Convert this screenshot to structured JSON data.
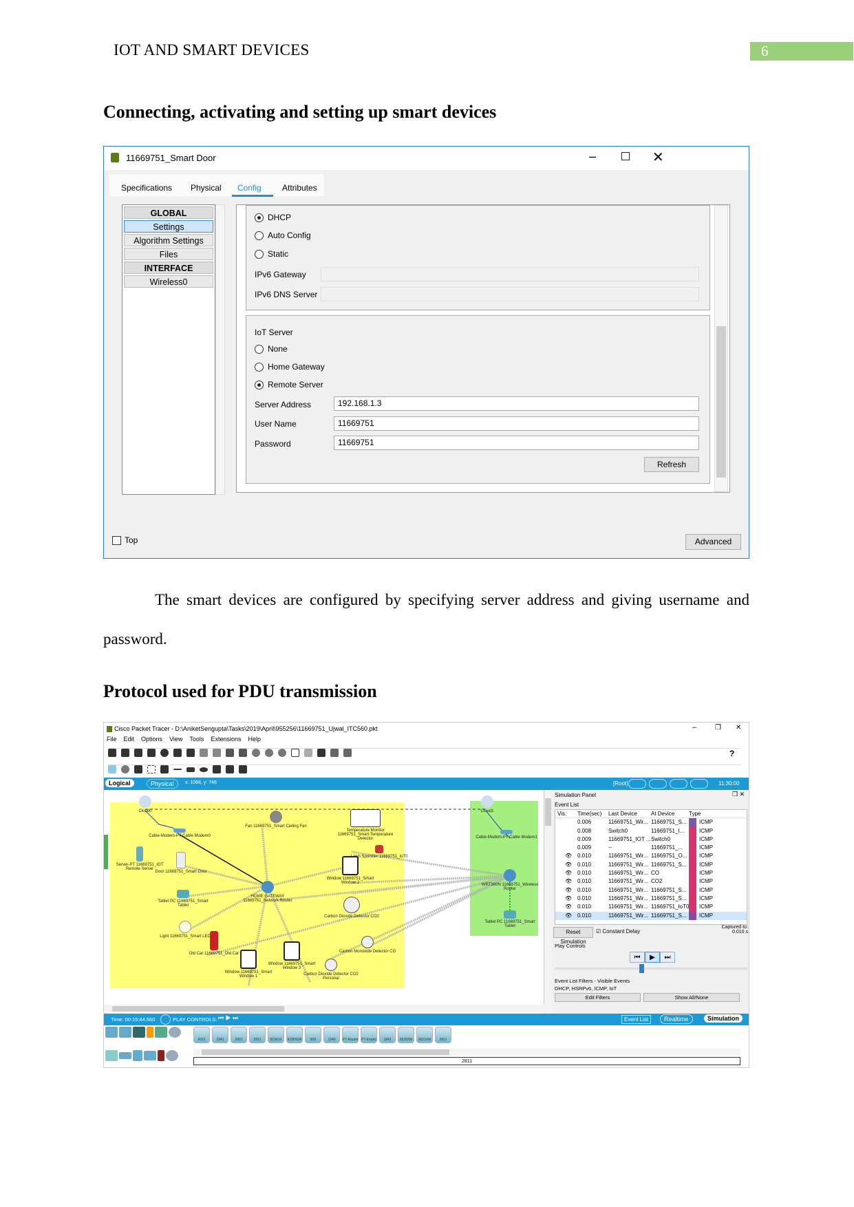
{
  "header": {
    "title": "IOT AND SMART DEVICES",
    "page_number": "6"
  },
  "section1": {
    "heading": "Connecting, activating and setting up smart devices"
  },
  "dialog": {
    "title": "11669751_Smart Door",
    "tabs": [
      "Specifications",
      "Physical",
      "Config",
      "Attributes"
    ],
    "active_tab": "Config",
    "left_items": [
      "GLOBAL",
      "Settings",
      "Algorithm Settings",
      "Files",
      "INTERFACE",
      "Wireless0"
    ],
    "ipv6": {
      "options": [
        {
          "label": "DHCP",
          "selected": true
        },
        {
          "label": "Auto Config",
          "selected": false
        },
        {
          "label": "Static",
          "selected": false
        }
      ],
      "gateway_label": "IPv6 Gateway",
      "gateway_value": "",
      "dns_label": "IPv6 DNS Server",
      "dns_value": ""
    },
    "iot": {
      "label": "IoT Server",
      "options": [
        {
          "label": "None",
          "selected": false
        },
        {
          "label": "Home Gateway",
          "selected": false
        },
        {
          "label": "Remote Server",
          "selected": true
        }
      ],
      "server_label": "Server Address",
      "server_value": "192.168.1.3",
      "user_label": "User Name",
      "user_value": "11669751",
      "password_label": "Password",
      "password_value": "11669751",
      "refresh": "Refresh"
    },
    "top_label": "Top",
    "top_checked": false,
    "advanced": "Advanced"
  },
  "paragraph": "The smart devices are configured by specifying server address and giving username and password.",
  "section2": {
    "heading": "Protocol used for PDU transmission"
  },
  "pt": {
    "title": "Cisco Packet Tracer - D:\\AniketSengupta\\Tasks\\2019\\April\\955256\\11669751_Ujwal_ITC560.pkt",
    "menu": [
      "File",
      "Edit",
      "Options",
      "View",
      "Tools",
      "Extensions",
      "Help"
    ],
    "help": "?",
    "logical": "Logical",
    "physical": "Physical",
    "coords": "x: 1088, y: 746",
    "root": "[Root]",
    "clock": "11:30:00",
    "devices": [
      {
        "label": "Cloud0"
      },
      {
        "label": "Cable-Modem-PT Cable Modem0"
      },
      {
        "label": "Server-PT 11669751_IOT Remote Server"
      },
      {
        "label": "Fan 11669751_Smart Ceiling Fan"
      },
      {
        "label": "Temperature Monitor 11669751_Smart Temperature Detector"
      },
      {
        "label": "Door 11669751_Smart Door"
      },
      {
        "label": "Lawn Sprinkler 11669751_IoT0"
      },
      {
        "label": "Window 11669751_Smart Window 2"
      },
      {
        "label": "HOME GATEWAY 11669751_Network Router"
      },
      {
        "label": "Tablet PC 11669751_Smart Tablet"
      },
      {
        "label": "Carbon Dioxide Detector CO2"
      },
      {
        "label": "Light 11669751_Smart LED"
      },
      {
        "label": "Old Car 11669751_Old Car"
      },
      {
        "label": "Window 11669751_Smart Window 1"
      },
      {
        "label": "Window 11669751_Smart Window 3"
      },
      {
        "label": "Carbon Monoxide Detector CO"
      },
      {
        "label": "Carbon Dioxide Detector CO2 Personal"
      },
      {
        "label": "Cloud1"
      },
      {
        "label": "Cable-Modem-PT Cable Modem1"
      },
      {
        "label": "WRT300N 11669751_Wireless Router"
      },
      {
        "label": "Tablet PC 11669751_Smart Tablet"
      }
    ],
    "sim": {
      "title": "Simulation Panel",
      "event_list": "Event List",
      "columns": [
        "Vis.",
        "Time(sec)",
        "Last Device",
        "At Device",
        "Type"
      ],
      "events": [
        {
          "vis": false,
          "time": "0.006",
          "last": "11669751_Wir...",
          "at": "11669751_S...",
          "type": "ICMP",
          "color": "#7a5aa8"
        },
        {
          "vis": false,
          "time": "0.008",
          "last": "Switch0",
          "at": "11669751_I...",
          "type": "ICMP",
          "color": "#d9336e"
        },
        {
          "vis": false,
          "time": "0.009",
          "last": "11669751_IOT ...",
          "at": "Switch0",
          "type": "ICMP",
          "color": "#d9336e"
        },
        {
          "vis": false,
          "time": "0.009",
          "last": "--",
          "at": "11669751_...",
          "type": "ICMP",
          "color": "#d9336e"
        },
        {
          "vis": true,
          "time": "0.010",
          "last": "11669751_Wir...",
          "at": "11669751_O...",
          "type": "ICMP",
          "color": "#d9336e"
        },
        {
          "vis": true,
          "time": "0.010",
          "last": "11669751_Wir...",
          "at": "11669751_S...",
          "type": "ICMP",
          "color": "#d9336e"
        },
        {
          "vis": true,
          "time": "0.010",
          "last": "11669751_Wir...",
          "at": "CO",
          "type": "ICMP",
          "color": "#d9336e"
        },
        {
          "vis": true,
          "time": "0.010",
          "last": "11669751_Wir...",
          "at": "CO2",
          "type": "ICMP",
          "color": "#d9336e"
        },
        {
          "vis": true,
          "time": "0.010",
          "last": "11669751_Wir...",
          "at": "11669751_S...",
          "type": "ICMP",
          "color": "#d9336e"
        },
        {
          "vis": true,
          "time": "0.010",
          "last": "11669751_Wir...",
          "at": "11669751_S...",
          "type": "ICMP",
          "color": "#d9336e"
        },
        {
          "vis": true,
          "time": "0.010",
          "last": "11669751_Wir...",
          "at": "11669751_IoT0",
          "type": "ICMP",
          "color": "#d9336e"
        },
        {
          "vis": true,
          "time": "0.010",
          "last": "11669751_Wir...",
          "at": "11669751_S...",
          "type": "ICMP",
          "color": "#8a4aa0",
          "selected": true
        }
      ],
      "reset": "Reset Simulation",
      "constant_delay": "Constant Delay",
      "constant_delay_checked": true,
      "captured_label": "Captured to:",
      "captured_value": "0.010 s",
      "play_controls": "Play Controls",
      "filters_label": "Event List Filters - Visible Events",
      "filters_value": "DHCP, HSRPv6, ICMP, IoT",
      "edit_filters": "Edit Filters",
      "show_all": "Show All/None"
    },
    "time": "Time: 00:15:44.560",
    "play_label": "PLAY CONTROLS:",
    "event_list_btn": "Event List",
    "realtime": "Realtime",
    "simulation": "Simulation",
    "palette": [
      "4321",
      "1941",
      "2901",
      "2911",
      "819IOX",
      "819HGW",
      "829",
      "1240",
      "PT-Router",
      "PT-Empty",
      "1841",
      "2620XM",
      "2621XM",
      "2811"
    ],
    "selected_model": "2811"
  }
}
